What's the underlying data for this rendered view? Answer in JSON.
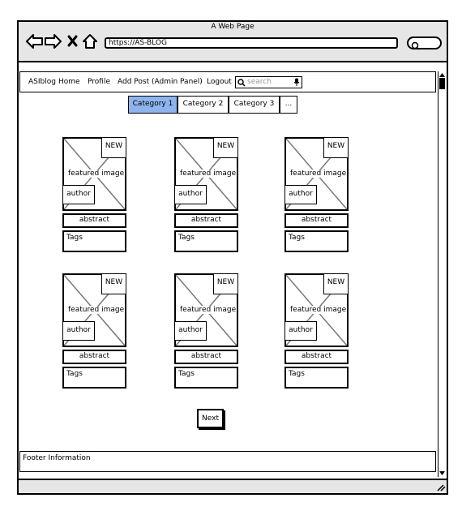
{
  "browser": {
    "title": "A Web Page",
    "url": "https://AS-BLOG"
  },
  "nav": {
    "brand": "ASIblog",
    "home": "Home",
    "profile": "Profile",
    "add_post": "Add Post (Admin Panel)",
    "logout": "Logout",
    "search_placeholder": "search"
  },
  "categories": [
    "Category 1",
    "Category 2",
    "Category 3",
    "..."
  ],
  "cards": [
    {
      "badge": "NEW",
      "image": "featured image",
      "author": "author",
      "abstract": "abstract",
      "tags": "Tags"
    },
    {
      "badge": "NEW",
      "image": "featured image",
      "author": "author",
      "abstract": "abstract",
      "tags": "Tags"
    },
    {
      "badge": "NEW",
      "image": "featured image",
      "author": "author",
      "abstract": "abstract",
      "tags": "Tags"
    },
    {
      "badge": "NEW",
      "image": "featured image",
      "author": "author",
      "abstract": "abstract",
      "tags": "Tags"
    },
    {
      "badge": "NEW",
      "image": "featured image",
      "author": "author",
      "abstract": "abstract",
      "tags": "Tags"
    },
    {
      "badge": "NEW",
      "image": "featured image",
      "author": "author",
      "abstract": "abstract",
      "tags": "Tags"
    }
  ],
  "pagination": {
    "next": "Next"
  },
  "footer": {
    "text": "Footer Information"
  }
}
